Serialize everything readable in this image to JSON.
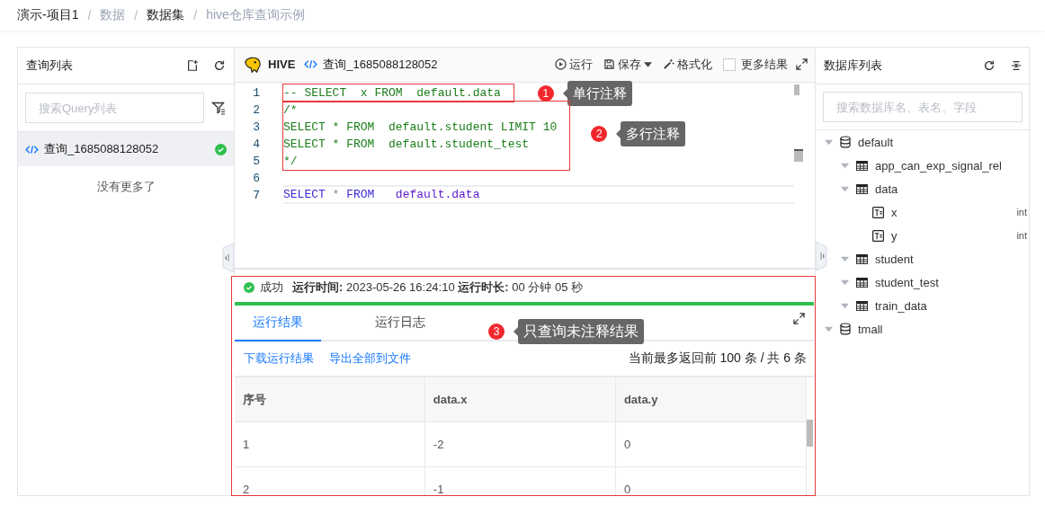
{
  "breadcrumb": [
    {
      "label": "演示-项目1",
      "muted": false
    },
    {
      "separator_before": "/",
      "label": "数据",
      "muted": true
    },
    {
      "separator_before": "/",
      "label": "数据集",
      "muted": false
    },
    {
      "separator_before": "/",
      "label": "hive仓库查询示例",
      "muted": true
    }
  ],
  "query_panel": {
    "title": "查询列表",
    "search": {
      "placeholder": "搜索Query列表"
    },
    "items": [
      {
        "name": "查询_1685088128052",
        "selected": true,
        "succeeded": true
      }
    ],
    "end_note": "没有更多了"
  },
  "editor": {
    "engine": "HIVE",
    "query_name": "查询_1685088128052",
    "toolbar": {
      "run": "运行",
      "save": "保存",
      "format": "格式化",
      "more_results": {
        "label": "更多结果",
        "checked": false
      }
    },
    "blocks": [
      {
        "highlight": true,
        "callout": {
          "number": "1",
          "text": "单行注释"
        },
        "lines": [
          {
            "number": "1",
            "current": false,
            "tokens": [
              {
                "kind": "comment",
                "text": "-- SELECT  x FROM  default.data"
              }
            ]
          }
        ]
      },
      {
        "highlight": true,
        "callout": {
          "number": "2",
          "text": "多行注释"
        },
        "lines": [
          {
            "number": "2",
            "current": false,
            "tokens": [
              {
                "kind": "comment",
                "text": "/*"
              }
            ]
          },
          {
            "number": "3",
            "current": false,
            "tokens": [
              {
                "kind": "comment",
                "text": "SELECT * FROM  default.student LIMIT 10"
              }
            ]
          },
          {
            "number": "4",
            "current": false,
            "tokens": [
              {
                "kind": "comment",
                "text": "SELECT * FROM  default.student_test"
              }
            ]
          },
          {
            "number": "5",
            "current": false,
            "tokens": [
              {
                "kind": "comment",
                "text": "*/"
              }
            ]
          }
        ]
      },
      {
        "highlight": false,
        "lines": [
          {
            "number": "6",
            "current": false
          },
          {
            "number": "7",
            "current": true,
            "tokens": [
              {
                "kind": "keyword",
                "text": "SELECT"
              },
              {
                "kind": "operator",
                "text": " * "
              },
              {
                "kind": "keyword",
                "text": "FROM"
              },
              {
                "kind": "identifier",
                "text": "   default.data"
              }
            ]
          }
        ]
      }
    ]
  },
  "results": {
    "status": "成功",
    "info": "**运行时间:** 2023-05-26 16:24:10  **运行时长:** 00 分钟 05 秒",
    "level": 1,
    "tabs": [
      {
        "label": "运行结果",
        "selected": true
      },
      {
        "label": "运行日志",
        "selected": false
      }
    ],
    "callout": {
      "number": "3",
      "text": "只查询未注释结果"
    },
    "links": [
      "下载运行结果",
      "导出全部到文件"
    ],
    "summary": "当前最多返回前 100 条 / 共 6 条",
    "table": {
      "columns": [
        "序号",
        "data.x",
        "data.y"
      ],
      "rows": [
        [
          "1",
          "-2",
          "0"
        ],
        [
          "2",
          "-1",
          "0"
        ]
      ]
    }
  },
  "database_panel": {
    "title": "数据库列表",
    "search": {
      "placeholder": "搜索数据库名、表名、字段"
    },
    "tree": [
      {
        "kind": "database",
        "name": "default",
        "expanded": true,
        "children": [
          {
            "kind": "table",
            "name": "app_can_exp_signal_rel",
            "expanded": true
          },
          {
            "kind": "table",
            "name": "data",
            "expanded": true,
            "children": [
              {
                "kind": "column",
                "name": "x",
                "type": "int"
              },
              {
                "kind": "column",
                "name": "y",
                "type": "int"
              }
            ]
          },
          {
            "kind": "table",
            "name": "student",
            "expanded": true
          },
          {
            "kind": "table",
            "name": "student_test",
            "expanded": true
          },
          {
            "kind": "table",
            "name": "train_data",
            "expanded": true
          }
        ]
      },
      {
        "kind": "database",
        "name": "tmall",
        "expanded": true
      }
    ]
  }
}
